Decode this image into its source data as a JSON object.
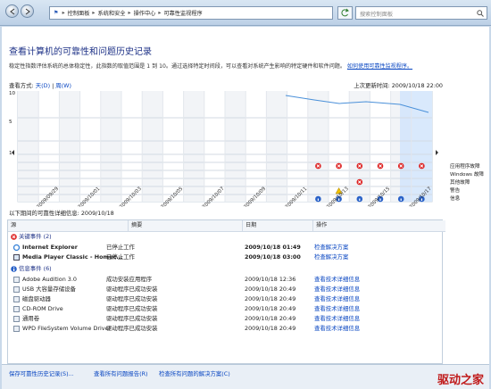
{
  "breadcrumbs": [
    "控制面板",
    "系统和安全",
    "操作中心",
    "可靠性监视程序"
  ],
  "search_placeholder": "搜索控制面板",
  "page_title": "查看计算机的可靠性和问题历史记录",
  "description": "稳定性指数评估系统的总体稳定性，此指数的取值范围是 1 到 10。通过选择特定时间段，可以查看对系统产生影响的特定硬件和软件问题。",
  "description_link": "如何使用可靠性监视程序。",
  "view_label": "查看方式:",
  "view_day": "天(D)",
  "view_week": "周(W)",
  "last_updated": "上次更新时间: 2009/10/18 22:00",
  "chart_data": {
    "type": "line",
    "x": [
      "2009/09/29",
      "2009/10/01",
      "2009/10/03",
      "2009/10/05",
      "2009/10/07",
      "2009/10/09",
      "2009/10/11",
      "2009/10/13",
      "2009/10/15",
      "2009/10/17"
    ],
    "y_ticks": [
      "10",
      "5",
      "1"
    ],
    "row_labels": [
      "应用程序故障",
      "Windows 故障",
      "其他故障",
      "警告",
      "信息"
    ]
  },
  "section_title": "以下期间的可靠性详细信息: 2009/10/18",
  "columns": [
    "源",
    "摘要",
    "日期",
    "操作"
  ],
  "groups": [
    {
      "name": "关键事件 (2)",
      "rows": [
        {
          "source": "Internet Explorer",
          "summary": "已停止工作",
          "date": "2009/10/18 01:49",
          "action": "检查解决方案"
        },
        {
          "source": "Media Player Classic - Homec...",
          "summary": "已停止工作",
          "date": "2009/10/18 03:00",
          "action": "检查解决方案"
        }
      ]
    },
    {
      "name": "信息事件 (6)",
      "rows": [
        {
          "source": "Adobe Audition 3.0",
          "summary": "成功安装应用程序",
          "date": "2009/10/18 12:36",
          "action": "查看技术详细信息"
        },
        {
          "source": "USB 大容量存储设备",
          "summary": "驱动程序已成功安装",
          "date": "2009/10/18 20:49",
          "action": "查看技术详细信息"
        },
        {
          "source": "磁盘驱动器",
          "summary": "驱动程序已成功安装",
          "date": "2009/10/18 20:49",
          "action": "查看技术详细信息"
        },
        {
          "source": "CD-ROM Drive",
          "summary": "驱动程序已成功安装",
          "date": "2009/10/18 20:49",
          "action": "查看技术详细信息"
        },
        {
          "source": "通用卷",
          "summary": "驱动程序已成功安装",
          "date": "2009/10/18 20:49",
          "action": "查看技术详细信息"
        },
        {
          "source": "WPD FileSystem Volume Driver",
          "summary": "驱动程序已成功安装",
          "date": "2009/10/18 20:49",
          "action": "查看技术详细信息"
        }
      ]
    }
  ],
  "footer": {
    "save": "保存可靠性历史记录(S)...",
    "view_all": "查看所有问题报告(R)",
    "check": "检查所有问题的解决方案(C)"
  },
  "watermark": "驱动之家"
}
